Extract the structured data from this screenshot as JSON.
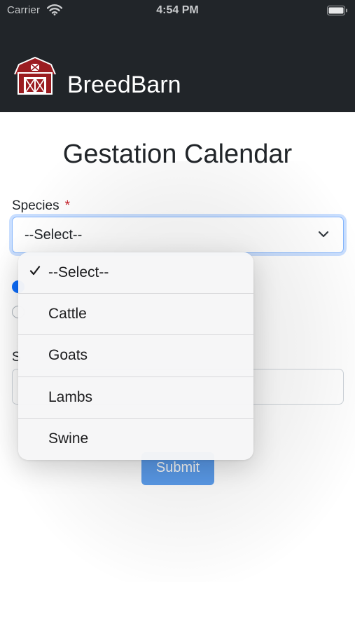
{
  "status_bar": {
    "carrier": "Carrier",
    "time": "4:54 PM",
    "wifi_icon": "wifi-icon",
    "battery_icon": "battery-icon"
  },
  "app": {
    "name": "BreedBarn",
    "logo_icon": "barn-icon"
  },
  "page": {
    "title": "Gestation Calendar"
  },
  "form": {
    "species_label": "Species",
    "required_marker": "*",
    "species_selected": "--Select--",
    "date_label_fragment": "S",
    "submit_label": "Submit"
  },
  "dropdown": {
    "options": [
      {
        "label": "--Select--",
        "selected": true
      },
      {
        "label": "Cattle",
        "selected": false
      },
      {
        "label": "Goats",
        "selected": false
      },
      {
        "label": "Lambs",
        "selected": false
      },
      {
        "label": "Swine",
        "selected": false
      }
    ]
  },
  "colors": {
    "header_bg": "#212529",
    "primary": "#0d6efd",
    "submit_bg": "#5c9eee",
    "required": "#c8232c",
    "barn_red": "#9b1c20"
  }
}
